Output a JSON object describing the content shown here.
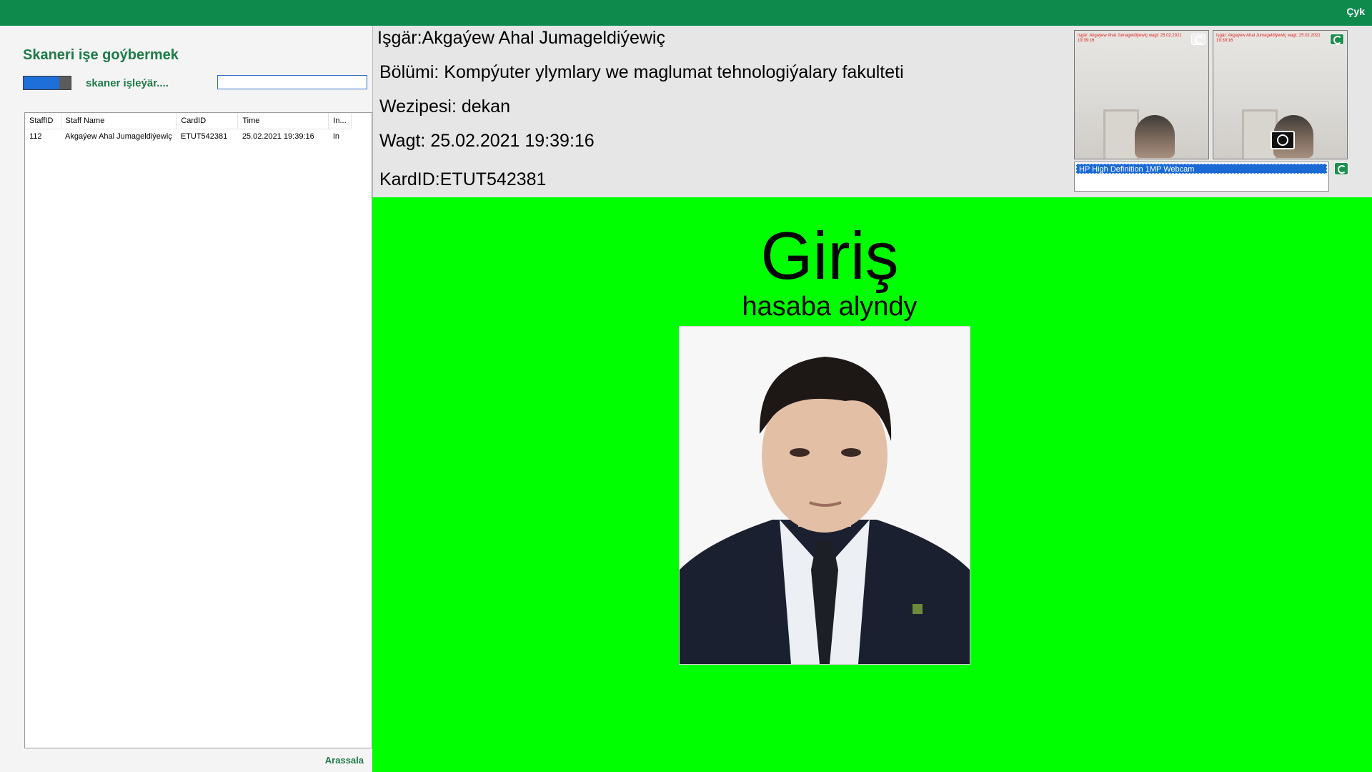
{
  "header": {
    "exit_label": "Çyk"
  },
  "scanner": {
    "title": "Skaneri işe goýbermek",
    "status": "skaner işleýär....",
    "input_value": "",
    "clear_label": "Arassala",
    "toggle_on": true
  },
  "log": {
    "columns": [
      "StaffID",
      "Staff Name",
      "CardID",
      "Time",
      "In..."
    ],
    "rows": [
      [
        "112",
        "Akgaýew Ahal Jumageldiýewiç",
        "ETUT542381",
        "25.02.2021 19:39:16",
        "In"
      ]
    ]
  },
  "info": {
    "employee": "Işgär:Akgaýew Ahal Jumageldiýewiç",
    "department": "Bölümi: Kompýuter ylymlary we maglumat tehnologiýalary fakulteti",
    "position": "Wezipesi: dekan",
    "time": "Wagt: 25.02.2021 19:39:16",
    "card": "KardID:ETUT542381"
  },
  "cameras": {
    "overlay_text_1": "Işgär: Akgaýew Ahal Jumageldiýewiç wagt: 25.02.2021 19:39:16",
    "overlay_text_2": "Işgär: Akgaýew Ahal Jumageldiýewiç wagt: 25.02.2021 19:39:16",
    "device": "HP High Definition 1MP Webcam"
  },
  "result": {
    "title": "Giriş",
    "subtitle": "hasaba alyndy",
    "bg_color": "#00ff00"
  },
  "colors": {
    "accent": "#0e8a4c",
    "text_green": "#1f7a49",
    "highlight": "#1a6ad6"
  }
}
